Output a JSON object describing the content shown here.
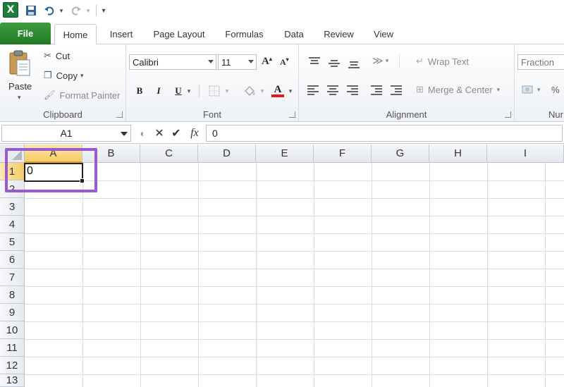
{
  "qat": {
    "app_icon": "excel-icon",
    "icons": [
      "save-icon",
      "undo-icon",
      "redo-icon",
      "customize-qat-icon"
    ]
  },
  "tabs": [
    {
      "label": "File"
    },
    {
      "label": "Home"
    },
    {
      "label": "Insert"
    },
    {
      "label": "Page Layout"
    },
    {
      "label": "Formulas"
    },
    {
      "label": "Data"
    },
    {
      "label": "Review"
    },
    {
      "label": "View"
    }
  ],
  "active_tab": "Home",
  "ribbon": {
    "clipboard": {
      "paste": "Paste",
      "cut": "Cut",
      "copy": "Copy",
      "format_painter": "Format Painter",
      "label": "Clipboard"
    },
    "font": {
      "font_name": "Calibri",
      "font_size": "11",
      "bold": "B",
      "italic": "I",
      "underline": "U",
      "label": "Font",
      "font_color": "#d42020"
    },
    "alignment": {
      "wrap_text": "Wrap Text",
      "merge_center": "Merge & Center",
      "label": "Alignment"
    },
    "number": {
      "format": "Fraction",
      "percent": "%",
      "label": "Nur"
    }
  },
  "formula_bar": {
    "name_box": "A1",
    "fx": "fx",
    "value": "0"
  },
  "grid": {
    "columns": [
      "A",
      "B",
      "C",
      "D",
      "E",
      "F",
      "G",
      "H",
      "I"
    ],
    "rows": [
      "1",
      "2",
      "3",
      "4",
      "5",
      "6",
      "7",
      "8",
      "9",
      "10",
      "11",
      "12",
      "13"
    ],
    "selected_column": "A",
    "selected_row": "1",
    "cell_A1": "0",
    "highlight_color": "#9b59d0"
  }
}
